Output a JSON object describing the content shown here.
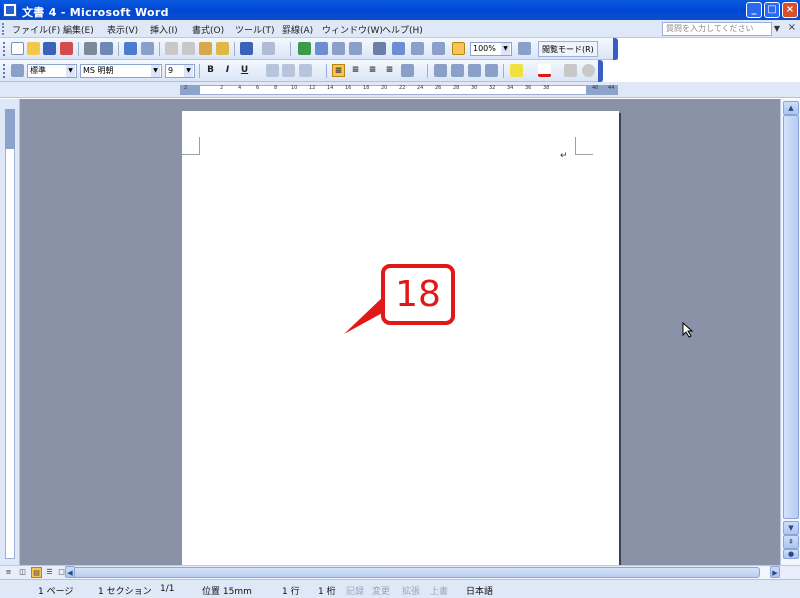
{
  "window": {
    "title": "文書 4 - Microsoft Word",
    "minimize": "_",
    "maximize": "□",
    "close": "×"
  },
  "menubar": {
    "items": [
      "ファイル(F)",
      "編集(E)",
      "表示(V)",
      "挿入(I)",
      "書式(O)",
      "ツール(T)",
      "罫線(A)",
      "ウィンドウ(W)",
      "ヘルプ(H)"
    ],
    "help_placeholder": "質問を入力してください",
    "close": "×"
  },
  "standard_toolbar": {
    "zoom": "100%",
    "reading_mode": "閲覧モード(R)"
  },
  "formatting_toolbar": {
    "style": "標準",
    "font": "MS 明朝",
    "font_size": "9",
    "bold": "B",
    "italic": "I",
    "underline": "U"
  },
  "ruler": {
    "ticks": [
      "2",
      "2",
      "4",
      "6",
      "8",
      "10",
      "12",
      "14",
      "16",
      "18",
      "20",
      "22",
      "24",
      "26",
      "28",
      "30",
      "32",
      "34",
      "36",
      "38",
      "40",
      "44"
    ]
  },
  "callout": {
    "number": "18"
  },
  "statusbar": {
    "page": "1 ページ",
    "section": "1 セクション",
    "page_of": "1/1",
    "position": "位置 15mm",
    "line": "1 行",
    "column": "1 桁",
    "rec": "記録",
    "trk": "変更",
    "ext": "拡張",
    "ovr": "上書",
    "language": "日本語"
  },
  "colors": {
    "titlebar": "#0a4ec8",
    "workspace": "#8a92a8",
    "callout_red": "#e01818"
  }
}
